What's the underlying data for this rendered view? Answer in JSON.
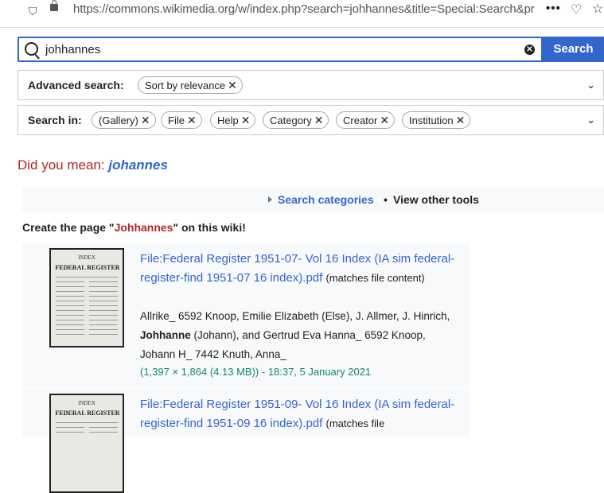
{
  "browser": {
    "url": "https://commons.wikimedia.org/w/index.php?search=johhannes&title=Special:Search&pr",
    "menu_dots": "•••"
  },
  "search": {
    "value": "johhannes",
    "button_label": "Search"
  },
  "advanced": {
    "label": "Advanced search:",
    "chips": [
      "Sort by relevance"
    ]
  },
  "search_in": {
    "label": "Search in:",
    "chips": [
      "(Gallery)",
      "File",
      "Help",
      "Category",
      "Creator",
      "Institution"
    ]
  },
  "did_you_mean": {
    "prefix": "Did you mean: ",
    "suggestion": "johannes"
  },
  "tools": {
    "search_categories": "Search categories",
    "separator": "•",
    "view_other": "View other tools"
  },
  "create": {
    "prefix": "Create the page \"",
    "page": "Johhannes",
    "suffix": "\" on this wiki!"
  },
  "results": [
    {
      "title": "File:Federal Register 1951-07- Vol 16 Index (IA sim federal-register-find 1951-07 16 index).pdf",
      "match_note": "(matches file content)",
      "snippet_pre": "Allrike_ 6592 Knoop, Emilie Elizabeth (Else), J. Allmer, J. Hinrich, ",
      "snippet_bold": "Johhanne",
      "snippet_post": " (Johann), and Gertrud Eva Hanna_ 6592 Knoop, Johann H_ 7442 Knuth, Anna_",
      "meta": "(1,397 × 1,864 (4.13 MB)) - 18:37, 5 January 2021",
      "thumb_top": "INDEX",
      "thumb_title": "FEDERAL REGISTER"
    },
    {
      "title": "File:Federal Register 1951-09- Vol 16 Index (IA sim federal-register-find 1951-09 16 index).pdf",
      "match_note": "(matches file",
      "thumb_top": "INDEX",
      "thumb_title": "FEDERAL REGISTER"
    }
  ]
}
